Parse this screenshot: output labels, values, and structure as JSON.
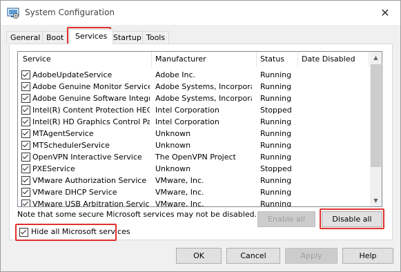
{
  "window": {
    "title": "System Configuration"
  },
  "tabs": [
    {
      "label": "General"
    },
    {
      "label": "Boot"
    },
    {
      "label": "Services"
    },
    {
      "label": "Startup"
    },
    {
      "label": "Tools"
    }
  ],
  "columns": [
    "Service",
    "Manufacturer",
    "Status",
    "Date Disabled"
  ],
  "services": [
    {
      "name": "AdobeUpdateService",
      "manufacturer": "Adobe Inc.",
      "status": "Running",
      "date_disabled": "",
      "checked": true
    },
    {
      "name": "Adobe Genuine Monitor Service",
      "manufacturer": "Adobe Systems, Incorpora...",
      "status": "Running",
      "date_disabled": "",
      "checked": true
    },
    {
      "name": "Adobe Genuine Software Integri...",
      "manufacturer": "Adobe Systems, Incorpora...",
      "status": "Running",
      "date_disabled": "",
      "checked": true
    },
    {
      "name": "Intel(R) Content Protection HEC...",
      "manufacturer": "Intel Corporation",
      "status": "Stopped",
      "date_disabled": "",
      "checked": true
    },
    {
      "name": "Intel(R) HD Graphics Control Pa...",
      "manufacturer": "Intel Corporation",
      "status": "Running",
      "date_disabled": "",
      "checked": true
    },
    {
      "name": "MTAgentService",
      "manufacturer": "Unknown",
      "status": "Running",
      "date_disabled": "",
      "checked": true
    },
    {
      "name": "MTSchedulerService",
      "manufacturer": "Unknown",
      "status": "Running",
      "date_disabled": "",
      "checked": true
    },
    {
      "name": "OpenVPN Interactive Service",
      "manufacturer": "The OpenVPN Project",
      "status": "Running",
      "date_disabled": "",
      "checked": true
    },
    {
      "name": "PXEService",
      "manufacturer": "Unknown",
      "status": "Stopped",
      "date_disabled": "",
      "checked": true
    },
    {
      "name": "VMware Authorization Service",
      "manufacturer": "VMware, Inc.",
      "status": "Running",
      "date_disabled": "",
      "checked": true
    },
    {
      "name": "VMware DHCP Service",
      "manufacturer": "VMware, Inc.",
      "status": "Running",
      "date_disabled": "",
      "checked": true
    },
    {
      "name": "VMware USB Arbitration Service",
      "manufacturer": "VMware, Inc.",
      "status": "Running",
      "date_disabled": "",
      "checked": true
    }
  ],
  "note": "Note that some secure Microsoft services may not be disabled.",
  "enable_all": "Enable all",
  "disable_all": "Disable all",
  "hide_ms_label": "Hide all Microsoft services",
  "hide_ms_checked": true,
  "footer": {
    "ok": "OK",
    "cancel": "Cancel",
    "apply": "Apply",
    "help": "Help"
  },
  "icons": {
    "app": "system-config-icon",
    "close": "close-icon",
    "scroll_up": "chevron-up-icon",
    "scroll_down": "chevron-down-icon"
  },
  "colors": {
    "highlight": "#e0302c",
    "accent": "#0078d7"
  }
}
